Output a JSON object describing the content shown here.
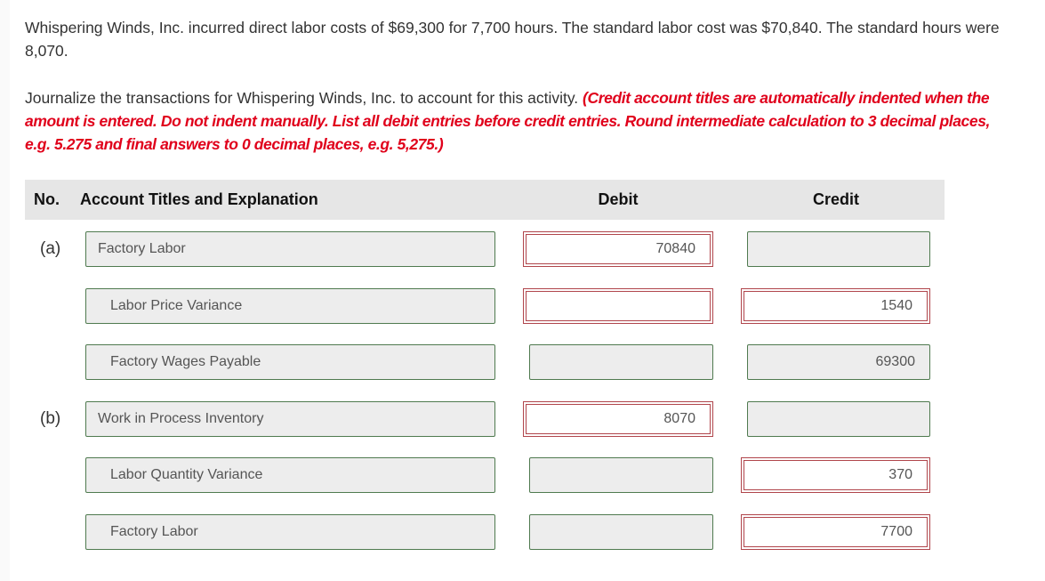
{
  "problem": {
    "statement": "Whispering Winds, Inc. incurred direct labor costs of $69,300 for 7,700 hours. The standard labor cost was $70,840. The standard hours were 8,070.",
    "instruction": "Journalize the transactions for Whispering Winds, Inc. to account for this activity.",
    "note": "(Credit account titles are automatically indented when the amount is entered. Do not indent manually. List all debit entries before credit entries. Round intermediate calculation to 3 decimal places, e.g. 5.275 and final answers to 0 decimal places, e.g. 5,275.)"
  },
  "table": {
    "headers": {
      "no": "No.",
      "account": "Account Titles and Explanation",
      "debit": "Debit",
      "credit": "Credit"
    },
    "rows": [
      {
        "no": "(a)",
        "account": "Factory Labor",
        "debit": "70840",
        "credit": "",
        "indent": false,
        "debit_status": "incorrect",
        "credit_status": "correct"
      },
      {
        "no": "",
        "account": "Labor Price Variance",
        "debit": "",
        "credit": "1540",
        "indent": true,
        "debit_status": "incorrect",
        "credit_status": "incorrect"
      },
      {
        "no": "",
        "account": "Factory Wages Payable",
        "debit": "",
        "credit": "69300",
        "indent": true,
        "debit_status": "correct",
        "credit_status": "correct"
      },
      {
        "no": "(b)",
        "account": "Work in Process Inventory",
        "debit": "8070",
        "credit": "",
        "indent": false,
        "debit_status": "incorrect",
        "credit_status": "correct"
      },
      {
        "no": "",
        "account": "Labor Quantity Variance",
        "debit": "",
        "credit": "370",
        "indent": true,
        "debit_status": "correct",
        "credit_status": "incorrect"
      },
      {
        "no": "",
        "account": "Factory Labor",
        "debit": "",
        "credit": "7700",
        "indent": true,
        "debit_status": "correct",
        "credit_status": "incorrect"
      }
    ]
  },
  "colors": {
    "correct_border": "#4f7a4f",
    "incorrect_border": "#b0454b",
    "instruction_red": "#e0001b",
    "header_bg": "#e6e6e6"
  }
}
